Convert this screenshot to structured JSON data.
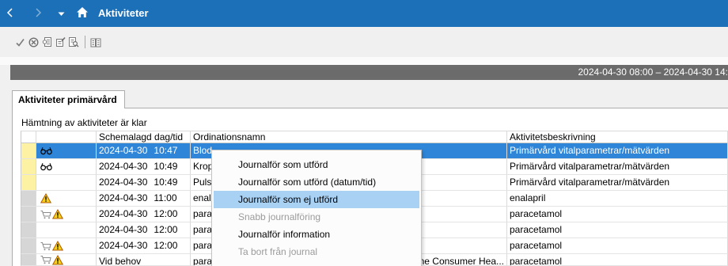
{
  "window": {
    "title": "Aktiviteter",
    "nav_icons": {
      "back": "chevron-left-icon",
      "forward": "chevron-right-icon",
      "menu": "chevron-down-icon",
      "home": "home-icon"
    }
  },
  "toolbar": {
    "items": [
      {
        "icon": "checkmark-icon"
      },
      {
        "icon": "circle-x-icon"
      },
      {
        "icon": "document-list-icon"
      },
      {
        "icon": "document-edit-icon"
      },
      {
        "icon": "document-search-icon"
      },
      {
        "type": "separator"
      },
      {
        "icon": "book-icon"
      }
    ]
  },
  "period_bar": {
    "text": "2024-04-30 08:00 – 2024-04-30 14:"
  },
  "tabs": [
    {
      "label": "Aktiviteter primärvård",
      "active": true
    }
  ],
  "status_text": "Hämtning av aktiviteter är klar",
  "table": {
    "columns": [
      "",
      "",
      "Schemalagd dag/tid",
      "Ordinationsnamn",
      "Aktivitetsbeskrivning"
    ],
    "rows": [
      {
        "marker": "yellow",
        "icons": [
          "glasses-icon"
        ],
        "date": "2024-04-30",
        "time": "10:47",
        "name": "Blod",
        "description": "Primärvård vitalparametrar/mätvärden",
        "selected": true
      },
      {
        "marker": "yellow",
        "icons": [
          "glasses-icon"
        ],
        "date": "2024-04-30",
        "time": "10:49",
        "name": "Krop",
        "description": "Primärvård vitalparametrar/mätvärden",
        "selected": false
      },
      {
        "marker": "yellow",
        "icons": [],
        "date": "2024-04-30",
        "time": "10:49",
        "name": "Puls",
        "description": "Primärvård vitalparametrar/mätvärden",
        "selected": false
      },
      {
        "marker": "gray",
        "icons": [
          "warning-icon"
        ],
        "date": "2024-04-30",
        "time": "11:00",
        "name": "enal",
        "description": "enalapril",
        "selected": false
      },
      {
        "marker": "gray",
        "icons": [
          "cart-icon",
          "warning-icon"
        ],
        "date": "2024-04-30",
        "time": "12:00",
        "name": "para",
        "description": "paracetamol",
        "selected": false
      },
      {
        "marker": "gray",
        "icons": [],
        "date": "2024-04-30",
        "time": "12:00",
        "name": "para",
        "description": "paracetamol",
        "selected": false
      },
      {
        "marker": "gray",
        "icons": [
          "cart-icon",
          "warning-icon"
        ],
        "date": "2024-04-30",
        "time": "12:00",
        "name": "para",
        "description": "paracetamol",
        "selected": false
      },
      {
        "marker": "gray",
        "icons": [
          "cart-icon",
          "warning-icon"
        ],
        "date": "Vid behov",
        "time": "",
        "name": "para",
        "name_tail": "ine Consumer Hea...",
        "description": "paracetamol",
        "selected": false
      }
    ]
  },
  "context_menu": {
    "items": [
      {
        "label": "Journalför som utförd",
        "enabled": true
      },
      {
        "label": "Journalför som utförd (datum/tid)",
        "enabled": true
      },
      {
        "label": "Journalför som ej utförd",
        "enabled": true
      },
      {
        "label": "Snabb journalföring",
        "enabled": false
      },
      {
        "label": "Journalför information",
        "enabled": true
      },
      {
        "label": "Ta bort från journal",
        "enabled": false
      }
    ],
    "highlighted_index": 2
  },
  "colors": {
    "title_bar": "#1c70b8",
    "period_bar": "#6b6b6b",
    "selection": "#2f86d8",
    "menu_highlight": "#a9d1f4",
    "marker_yellow": "#fdf2a4",
    "marker_gray": "#d6d6d6",
    "disabled_text": "#9b9b9b"
  }
}
